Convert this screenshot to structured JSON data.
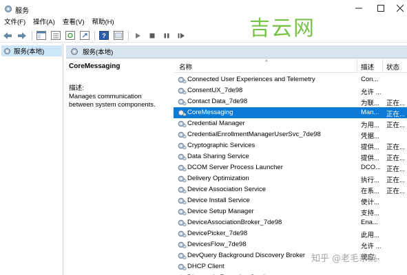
{
  "window": {
    "title": "服务"
  },
  "menu": [
    "文件(F)",
    "操作(A)",
    "查看(V)",
    "帮助(H)"
  ],
  "tree": {
    "root_label": "服务(本地)"
  },
  "panel": {
    "header_label": "服务(本地)"
  },
  "details": {
    "service_name": "CoreMessaging",
    "description_caption": "描述:",
    "description_text": "Manages communication between system components."
  },
  "list": {
    "columns": {
      "name": "名称",
      "description": "描述",
      "status": "状态"
    },
    "rows": [
      {
        "name": "Connected User Experiences and Telemetry",
        "description": "Con...",
        "status": ""
      },
      {
        "name": "ConsentUX_7de98",
        "description": "允许 ...",
        "status": ""
      },
      {
        "name": "Contact Data_7de98",
        "description": "为联...",
        "status": "正在..."
      },
      {
        "name": "CoreMessaging",
        "description": "Man...",
        "status": "正在...",
        "selected": true
      },
      {
        "name": "Credential Manager",
        "description": "为用...",
        "status": "正在..."
      },
      {
        "name": "CredentialEnrollmentManagerUserSvc_7de98",
        "description": "凭据...",
        "status": ""
      },
      {
        "name": "Cryptographic Services",
        "description": "提供...",
        "status": "正在..."
      },
      {
        "name": "Data Sharing Service",
        "description": "提供...",
        "status": "正在..."
      },
      {
        "name": "DCOM Server Process Launcher",
        "description": "DCO...",
        "status": "正在..."
      },
      {
        "name": "Delivery Optimization",
        "description": "执行...",
        "status": "正在..."
      },
      {
        "name": "Device Association Service",
        "description": "在系...",
        "status": "正在..."
      },
      {
        "name": "Device Install Service",
        "description": "使计...",
        "status": ""
      },
      {
        "name": "Device Setup Manager",
        "description": "支持...",
        "status": ""
      },
      {
        "name": "DeviceAssociationBroker_7de98",
        "description": "Ena...",
        "status": ""
      },
      {
        "name": "DevicePicker_7de98",
        "description": "此用...",
        "status": ""
      },
      {
        "name": "DevicesFlow_7de98",
        "description": "允许 ...",
        "status": ""
      },
      {
        "name": "DevQuery Background Discovery Broker",
        "description": "使应...",
        "status": ""
      },
      {
        "name": "DHCP Client",
        "description": "",
        "status": ""
      },
      {
        "name": "Diagnostic Execution Service",
        "description": "",
        "status": ""
      }
    ]
  },
  "watermarks": {
    "top": "吉云网",
    "bottom": "知乎 @老毛系统"
  },
  "colors": {
    "selection": "#0c7bd6",
    "header_bar": "#d8e4ef",
    "tree_selection": "#cde6f7"
  }
}
